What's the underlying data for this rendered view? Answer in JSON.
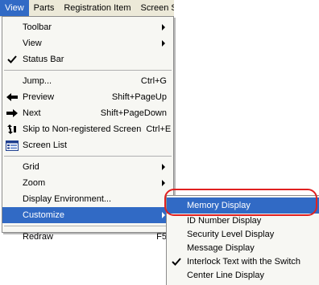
{
  "menubar": {
    "items": [
      "View",
      "Parts",
      "Registration Item",
      "Screen Se"
    ]
  },
  "view_menu": {
    "items": [
      {
        "label": "Toolbar",
        "submenu": true
      },
      {
        "label": "View",
        "submenu": true
      },
      {
        "label": "Status Bar",
        "checked": true
      },
      {
        "label": "Jump...",
        "shortcut": "Ctrl+G"
      },
      {
        "label": "Preview",
        "shortcut": "Shift+PageUp"
      },
      {
        "label": "Next",
        "shortcut": "Shift+PageDown"
      },
      {
        "label": "Skip to Non-registered Screen",
        "shortcut": "Ctrl+E"
      },
      {
        "label": "Screen List"
      },
      {
        "label": "Grid",
        "submenu": true
      },
      {
        "label": "Zoom",
        "submenu": true
      },
      {
        "label": "Display Environment..."
      },
      {
        "label": "Customize",
        "submenu": true
      },
      {
        "label": "Redraw",
        "shortcut": "F5"
      }
    ]
  },
  "customize_submenu": {
    "items": [
      {
        "label": "Memory Display"
      },
      {
        "label": "ID Number Display"
      },
      {
        "label": "Security Level Display"
      },
      {
        "label": "Message Display"
      },
      {
        "label": "Interlock Text with the Switch",
        "checked": true
      },
      {
        "label": "Center Line Display"
      }
    ]
  },
  "colors": {
    "highlight": "#316ac5",
    "annotation_ring": "#e02020"
  }
}
